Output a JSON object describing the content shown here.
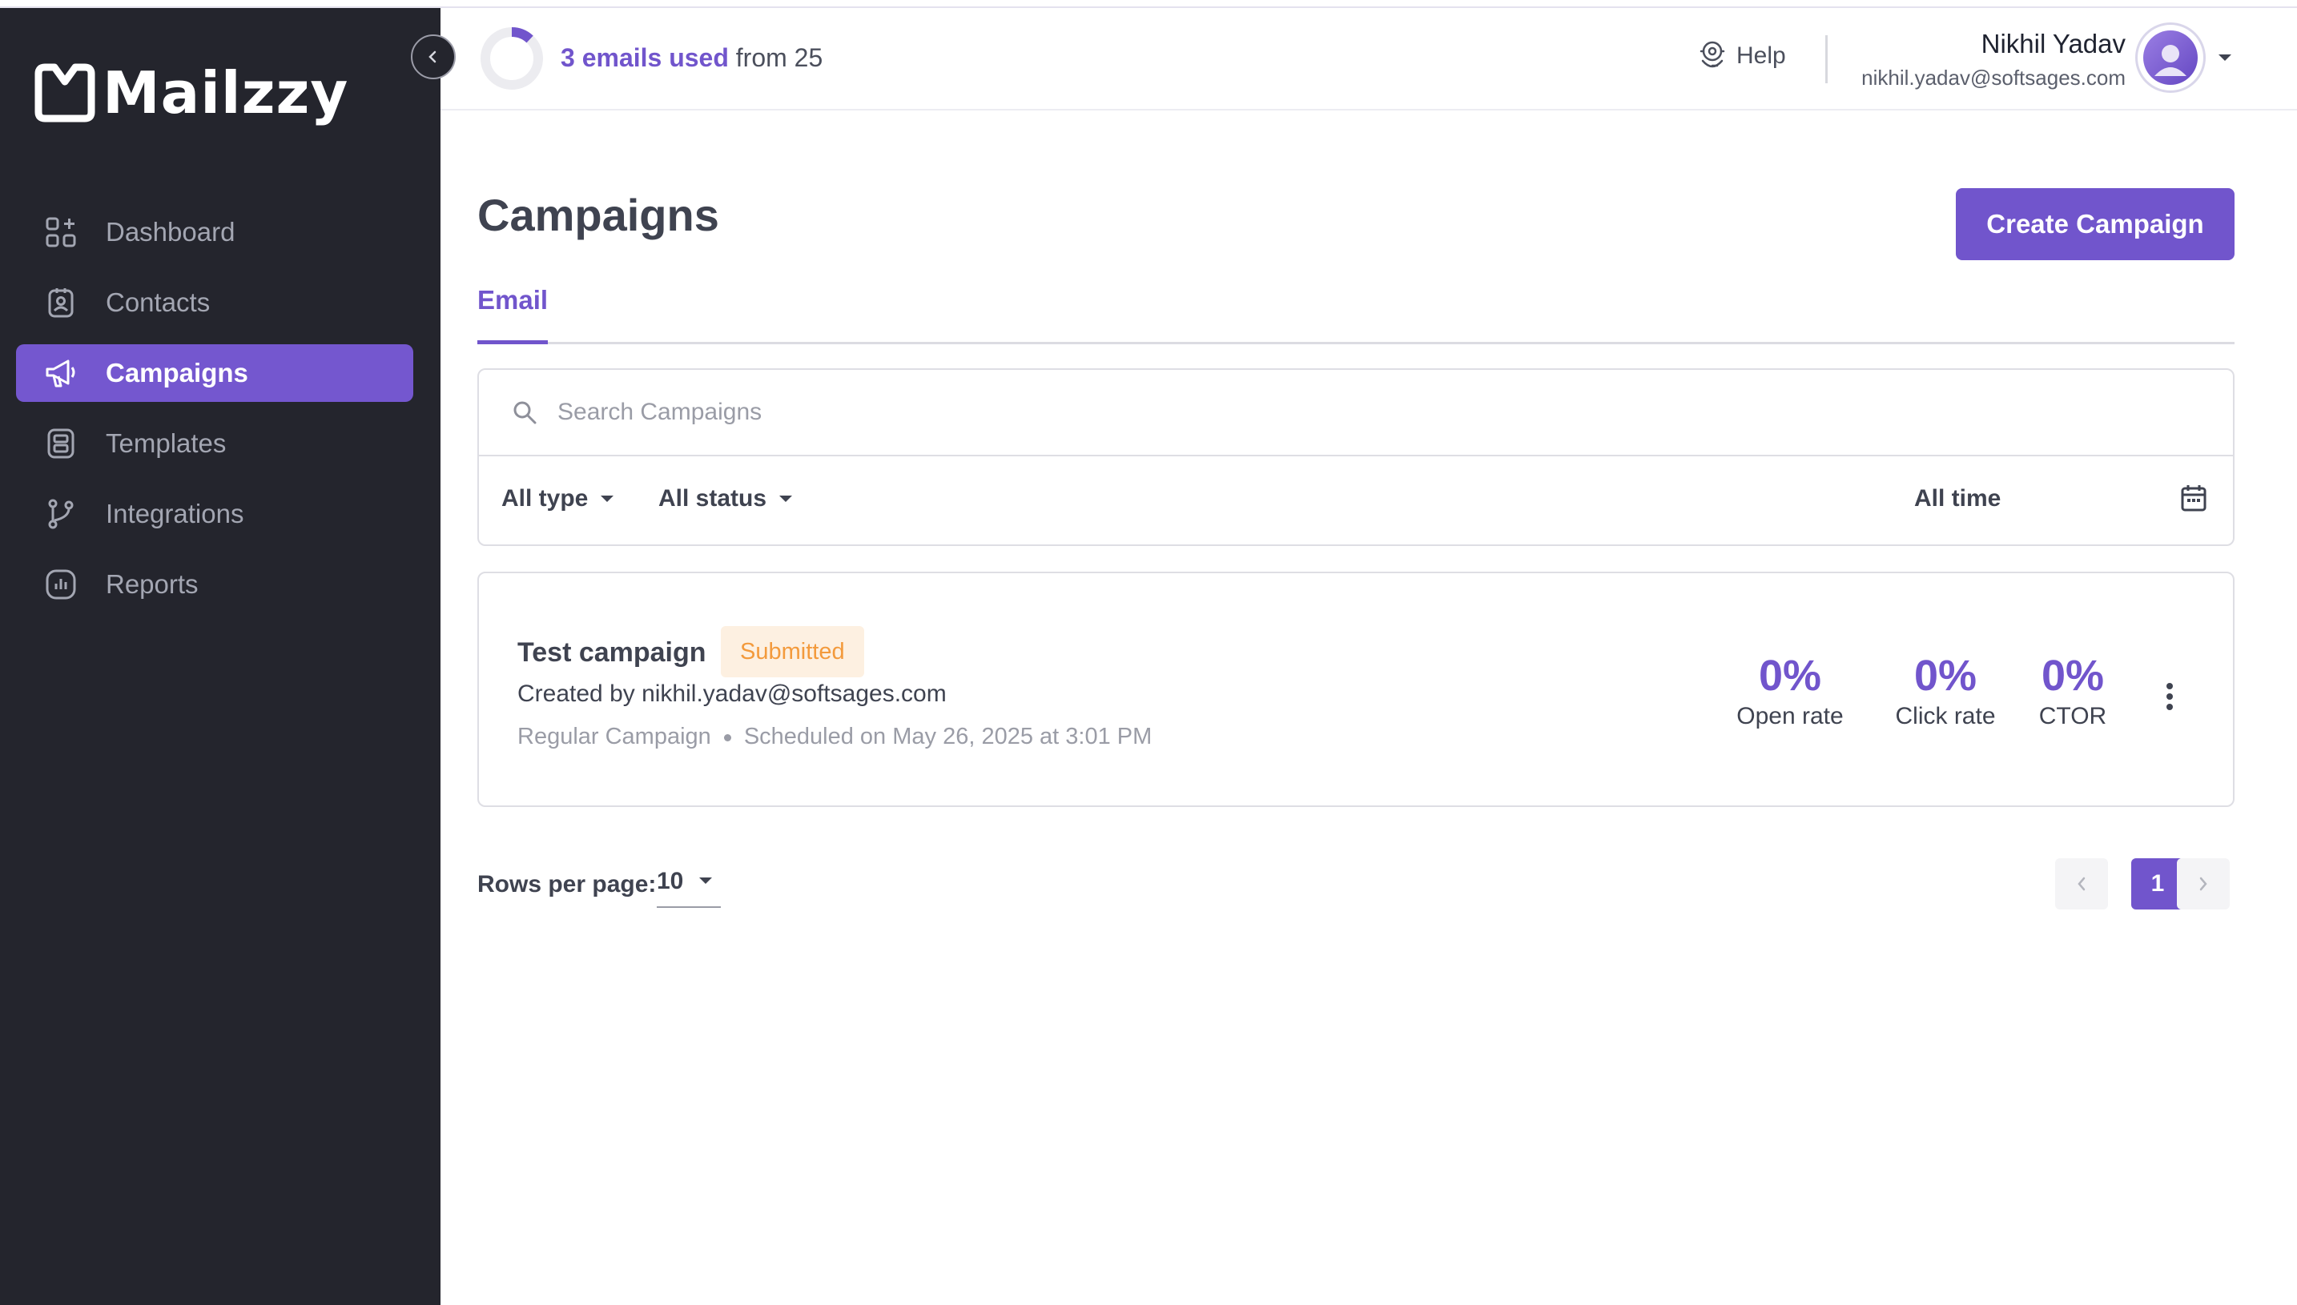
{
  "app": {
    "logo_text": "Mailzzy"
  },
  "sidebar": {
    "items": [
      {
        "label": "Dashboard",
        "icon": "dashboard-icon",
        "active": false
      },
      {
        "label": "Contacts",
        "icon": "contacts-icon",
        "active": false
      },
      {
        "label": "Campaigns",
        "icon": "megaphone-icon",
        "active": true
      },
      {
        "label": "Templates",
        "icon": "templates-icon",
        "active": false
      },
      {
        "label": "Integrations",
        "icon": "branch-icon",
        "active": false
      },
      {
        "label": "Reports",
        "icon": "reports-icon",
        "active": false
      }
    ]
  },
  "header": {
    "usage_used": "3 emails used",
    "usage_rest": " from 25",
    "usage_fraction": 0.12,
    "help_label": "Help",
    "user_name": "Nikhil Yadav",
    "user_email": "nikhil.yadav@softsages.com"
  },
  "page": {
    "title": "Campaigns",
    "create_button": "Create Campaign",
    "tabs": [
      {
        "label": "Email",
        "active": true
      }
    ]
  },
  "filters": {
    "search_placeholder": "Search Campaigns",
    "search_value": "",
    "type_filter": "All type",
    "status_filter": "All status",
    "time_filter": "All time"
  },
  "campaigns": [
    {
      "name": "Test campaign",
      "status": "Submitted",
      "created_by": "Created by nikhil.yadav@softsages.com",
      "campaign_type": "Regular Campaign",
      "scheduled": "Scheduled on May 26, 2025 at 3:01 PM",
      "stats": [
        {
          "value": "0%",
          "label": "Open rate"
        },
        {
          "value": "0%",
          "label": "Click rate"
        },
        {
          "value": "0%",
          "label": "CTOR"
        }
      ]
    }
  ],
  "pagination": {
    "rows_label": "Rows per page:",
    "rows_value": "10",
    "current_page": "1"
  },
  "colors": {
    "accent": "#7155cc",
    "sidebar_bg": "#24252d",
    "badge_bg": "#fdf0e1",
    "badge_text": "#f39a3c"
  }
}
